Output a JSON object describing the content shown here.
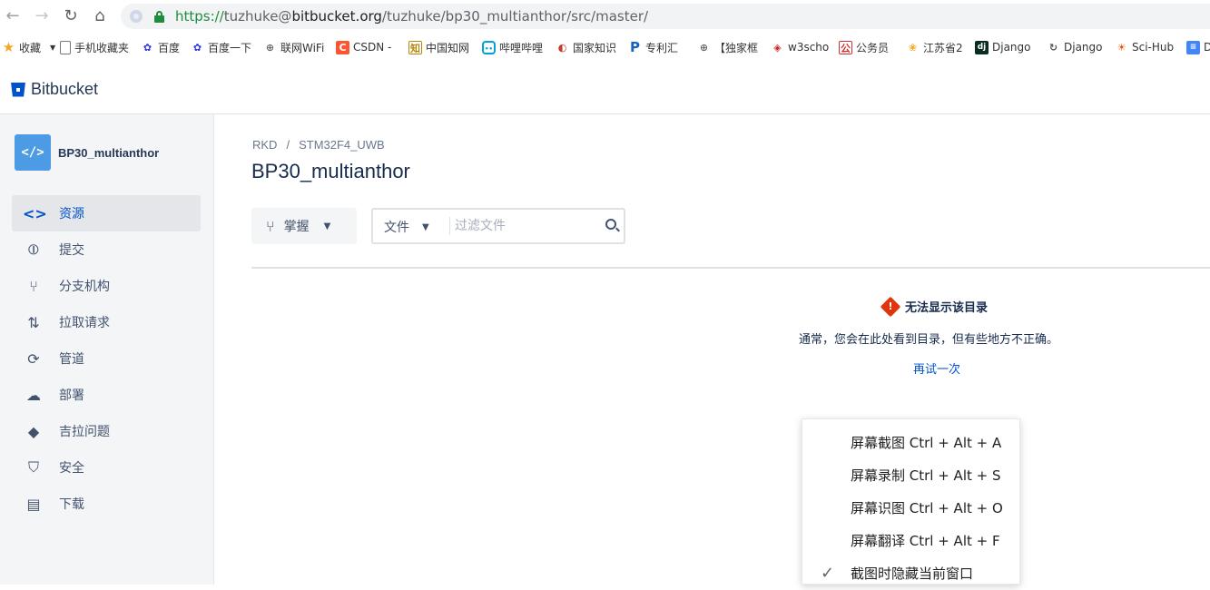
{
  "browser": {
    "url_scheme": "https://",
    "url_user": "tuzhuke@",
    "url_host": "bitbucket.org",
    "url_path": "/tuzhuke/bp30_multianthor/src/master/"
  },
  "bookmarks": [
    {
      "label": "收藏",
      "icon": "star-icon",
      "color": "#f5a623"
    },
    {
      "label": "手机收藏夹",
      "icon": "folder-icon",
      "color": "#555555"
    },
    {
      "label": "百度",
      "icon": "baidu-icon",
      "color": "#2932e1"
    },
    {
      "label": "百度一下",
      "icon": "baidu-icon",
      "color": "#2932e1"
    },
    {
      "label": "联网WiFi",
      "icon": "globe-icon",
      "color": "#666666"
    },
    {
      "label": "CSDN -",
      "icon": "csdn-icon",
      "color": "#fc5531"
    },
    {
      "label": "中国知网",
      "icon": "cnki-icon",
      "color": "#b8860b"
    },
    {
      "label": "哔哩哔哩",
      "icon": "bilibili-icon",
      "color": "#00a1d6"
    },
    {
      "label": "国家知识",
      "icon": "patent-icon",
      "color": "#c0392b"
    },
    {
      "label": "专利汇",
      "icon": "p-icon",
      "color": "#1565c0"
    },
    {
      "label": "【独家框",
      "icon": "globe-icon",
      "color": "#666666"
    },
    {
      "label": "w3scho",
      "icon": "w3-icon",
      "color": "#c62828"
    },
    {
      "label": "公务员",
      "icon": "gov-icon",
      "color": "#d32f2f"
    },
    {
      "label": "江苏省2",
      "icon": "flower-icon",
      "color": "#f9a825"
    },
    {
      "label": "Django",
      "icon": "django-icon",
      "color": "#092e20"
    },
    {
      "label": "Django",
      "icon": "django-alt-icon",
      "color": "#555555"
    },
    {
      "label": "Sci-Hub",
      "icon": "scihub-icon",
      "color": "#e65100"
    },
    {
      "label": "D",
      "icon": "doc-icon",
      "color": "#4285f4"
    }
  ],
  "header": {
    "brand": "Bitbucket"
  },
  "sidebar": {
    "repo_name": "BP30_multianthor",
    "repo_avatar": "</>",
    "items": [
      {
        "label": "资源",
        "icon": "source-code-icon",
        "active": true
      },
      {
        "label": "提交",
        "icon": "commit-icon",
        "active": false
      },
      {
        "label": "分支机构",
        "icon": "branch-icon",
        "active": false
      },
      {
        "label": "拉取请求",
        "icon": "pull-request-icon",
        "active": false
      },
      {
        "label": "管道",
        "icon": "pipeline-icon",
        "active": false
      },
      {
        "label": "部署",
        "icon": "deploy-cloud-icon",
        "active": false
      },
      {
        "label": "吉拉问题",
        "icon": "jira-icon",
        "active": false
      },
      {
        "label": "安全",
        "icon": "shield-icon",
        "active": false
      },
      {
        "label": "下载",
        "icon": "download-file-icon",
        "active": false
      }
    ]
  },
  "main": {
    "breadcrumb": [
      "RKD",
      "/",
      "STM32F4_UWB"
    ],
    "title": "BP30_multianthor",
    "branch_label": "掌握",
    "filter_type": "文件",
    "filter_placeholder": "过滤文件",
    "error_title": "无法显示该目录",
    "error_desc": "通常，您会在此处看到目录，但有些地方不正确。",
    "retry": "再试一次"
  },
  "context_menu": [
    {
      "label": "屏幕截图 Ctrl + Alt + A",
      "checked": false
    },
    {
      "label": "屏幕录制 Ctrl + Alt + S",
      "checked": false
    },
    {
      "label": "屏幕识图 Ctrl + Alt + O",
      "checked": false
    },
    {
      "label": "屏幕翻译 Ctrl + Alt + F",
      "checked": false
    },
    {
      "label": "截图时隐藏当前窗口",
      "checked": true
    }
  ]
}
